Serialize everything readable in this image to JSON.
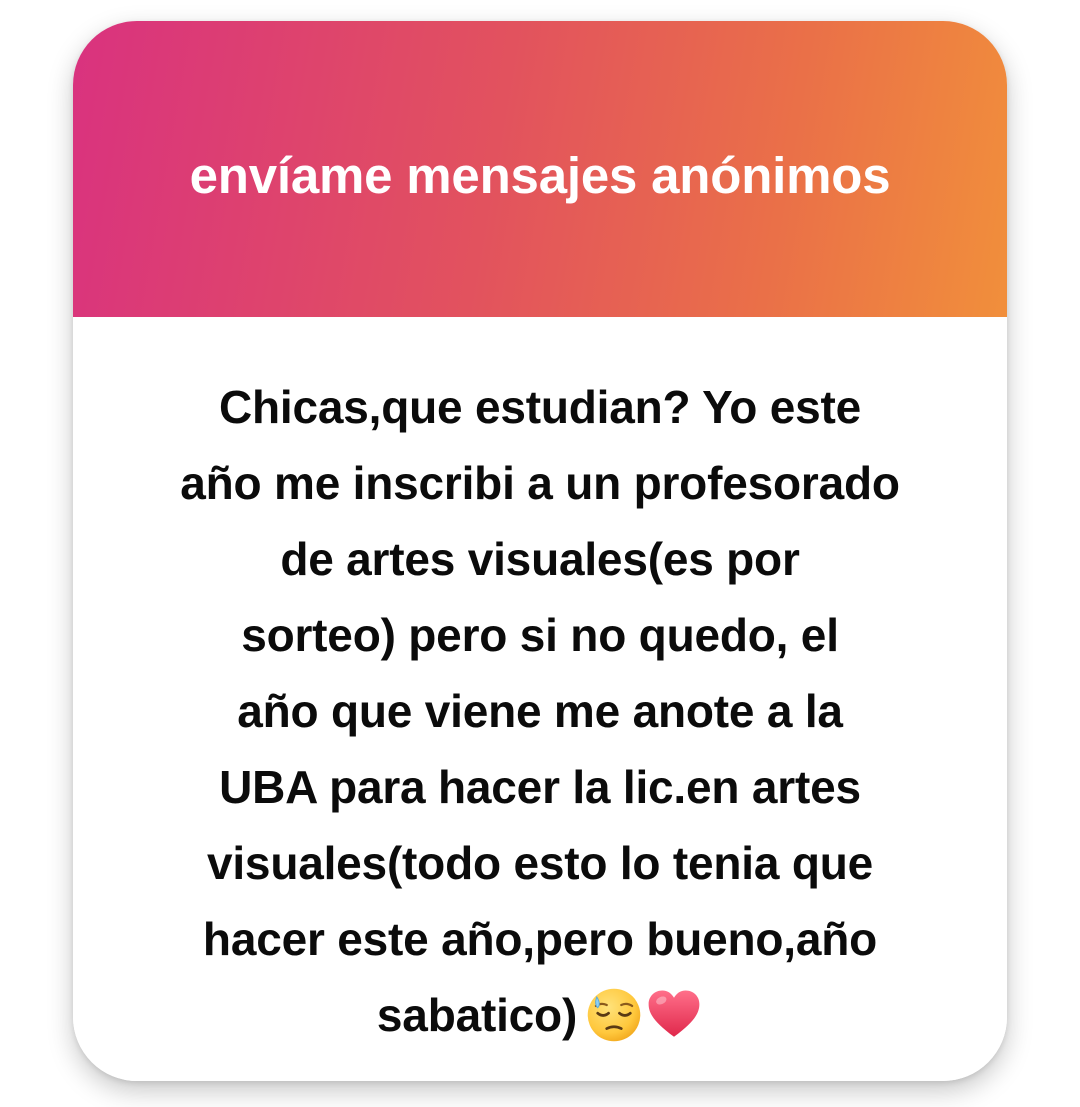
{
  "card": {
    "title": "envíame mensajes anónimos",
    "message_lines": [
      "Chicas,que estudian? Yo este",
      "año me inscribi a un profesorado",
      "de artes visuales(es por",
      "sorteo) pero si no quedo, el",
      "año que viene me anote a la",
      "UBA para hacer la lic.en artes",
      "visuales(todo esto lo tenia que",
      "hacer este año,pero bueno,año",
      "sabatico)"
    ],
    "emojis": [
      "sleepy-face-icon",
      "red-heart-icon"
    ]
  },
  "colors": {
    "gradient_start": "#d9327f",
    "gradient_end": "#f18f3b",
    "title_text": "#ffffff",
    "message_text": "#0b0b0b",
    "card_background": "#ffffff"
  }
}
